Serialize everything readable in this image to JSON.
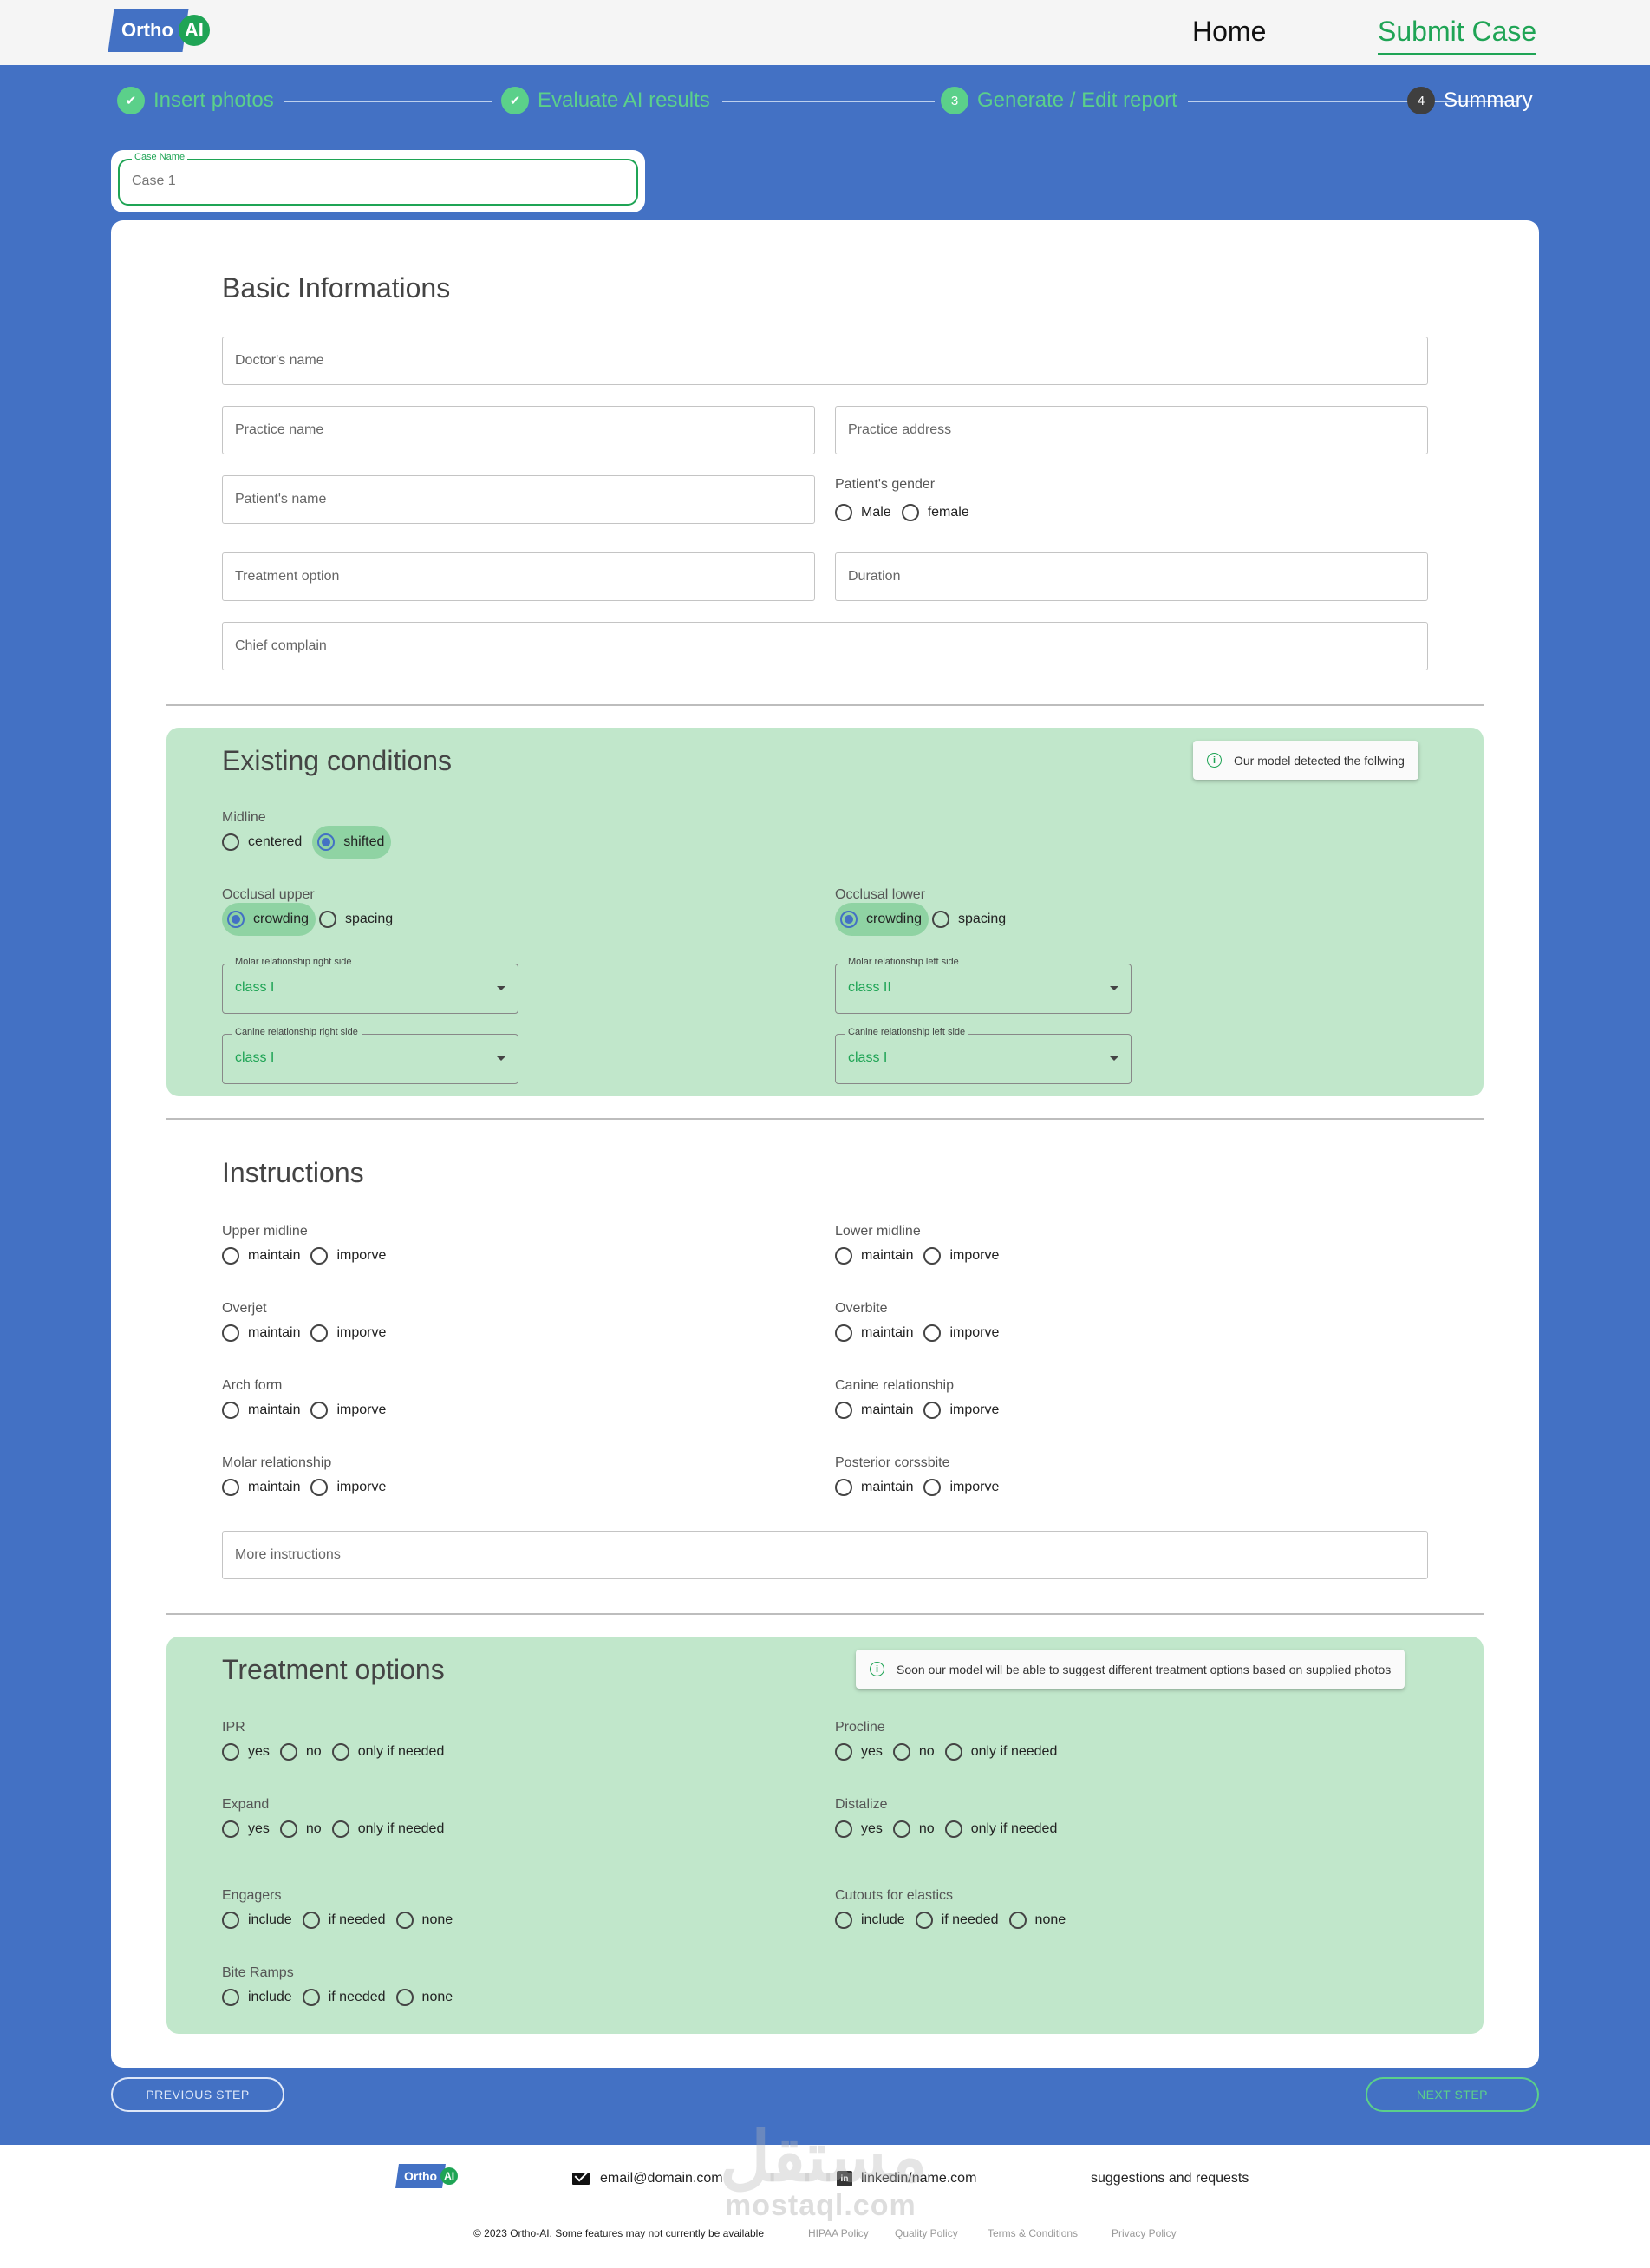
{
  "header": {
    "logo_text": "Ortho",
    "logo_badge": "AI",
    "nav_home": "Home",
    "nav_submit": "Submit Case"
  },
  "stepper": {
    "steps": [
      {
        "label": "Insert photos",
        "state": "done",
        "icon": "check-icon"
      },
      {
        "label": "Evaluate AI results",
        "state": "done",
        "icon": "check-icon"
      },
      {
        "label": "Generate / Edit report",
        "state": "active",
        "number": "3"
      },
      {
        "label": "Summary",
        "state": "pending",
        "number": "4"
      }
    ]
  },
  "case": {
    "label": "Case Name",
    "placeholder": "Case 1"
  },
  "basic": {
    "title": "Basic Informations",
    "doctor": "Doctor's name",
    "practice_name": "Practice name",
    "practice_address": "Practice address",
    "patient_name": "Patient's name",
    "gender_label": "Patient's gender",
    "gender_options": [
      "Male",
      "female"
    ],
    "treatment_option": "Treatment option",
    "duration": "Duration",
    "chief": "Chief complain"
  },
  "existing": {
    "title": "Existing conditions",
    "note": "Our model detected the follwing",
    "midline_label": "Midline",
    "midline_options": [
      "centered",
      "shifted"
    ],
    "midline_selected": "shifted",
    "occ_upper_label": "Occlusal upper",
    "occ_upper_options": [
      "crowding",
      "spacing"
    ],
    "occ_upper_selected": "crowding",
    "occ_lower_label": "Occlusal lower",
    "occ_lower_options": [
      "crowding",
      "spacing"
    ],
    "occ_lower_selected": "crowding",
    "molar_right_label": "Molar relationship right side",
    "molar_right_value": "class I",
    "molar_left_label": "Molar relationship left side",
    "molar_left_value": "class II",
    "canine_right_label": "Canine relationship right side",
    "canine_right_value": "class I",
    "canine_left_label": "Canine relationship left side",
    "canine_left_value": "class I"
  },
  "instructions": {
    "title": "Instructions",
    "opt_maintain": "maintain",
    "opt_improve": "imporve",
    "upper_midline": "Upper midline",
    "lower_midline": "Lower midline",
    "overjet": "Overjet",
    "overbite": "Overbite",
    "arch_form": "Arch form",
    "canine_relationship": "Canine relationship",
    "molar_relationship": "Molar relationship",
    "posterior_crossbite": "Posterior corssbite",
    "more": "More instructions"
  },
  "treatment": {
    "title": "Treatment options",
    "note": "Soon our model will be able to suggest different treatment options based on supplied photos",
    "opt_yes": "yes",
    "opt_no": "no",
    "opt_if": "only if needed",
    "opt_include": "include",
    "opt_ifneeded": "if needed",
    "opt_none": "none",
    "ipr": "IPR",
    "procline": "Procline",
    "expand": "Expand",
    "distalize": "Distalize",
    "engagers": "Engagers",
    "cutouts": "Cutouts for elastics",
    "bite_ramps": "Bite Ramps"
  },
  "buttons": {
    "prev": "PREVIOUS STEP",
    "next": "NEXT STEP"
  },
  "footer": {
    "logo_text": "Ortho",
    "logo_badge": "AI",
    "email": "email@domain.com",
    "linkedin": "linkedin/name.com",
    "suggestions": "suggestions and requests",
    "copyright": "© 2023 Ortho-AI. Some features may not currently be available",
    "links": [
      "HIPAA Policy",
      "Quality Policy",
      "Terms & Conditions",
      "Privacy Policy"
    ]
  },
  "watermark": {
    "arabic": "مستقل",
    "latin": "mostaql.com"
  },
  "colors": {
    "primary_blue": "#4371c4",
    "accent_green": "#1fa455",
    "section_green": "#c1e7cb"
  }
}
